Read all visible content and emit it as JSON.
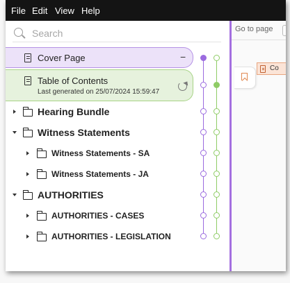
{
  "menu": [
    "File",
    "Edit",
    "View",
    "Help"
  ],
  "search": {
    "placeholder": "Search"
  },
  "tree": {
    "cover": {
      "label": "Cover Page",
      "action": "−"
    },
    "toc": {
      "label": "Table of Contents",
      "subtitle": "Last generated on 25/07/2024 15:59:47"
    },
    "hearing": {
      "label": "Hearing Bundle"
    },
    "witness": {
      "label": "Witness Statements"
    },
    "witness_sa": {
      "label": "Witness Statements - SA"
    },
    "witness_ja": {
      "label": "Witness Statements - JA"
    },
    "authorities": {
      "label": "AUTHORITIES"
    },
    "auth_cases": {
      "label": "AUTHORITIES - CASES"
    },
    "auth_leg": {
      "label": "AUTHORITIES - LEGISLATION"
    }
  },
  "right_panel": {
    "goto_label": "Go to page",
    "chip_label": "Co"
  },
  "colors": {
    "accent_purple": "#9b6bdf",
    "accent_green": "#8fcc66",
    "menubar": "#141414"
  },
  "icons": [
    "search-icon",
    "document-icon",
    "folder-icon",
    "refresh-icon",
    "bookmark-icon",
    "caret-right-icon",
    "caret-down-icon"
  ]
}
